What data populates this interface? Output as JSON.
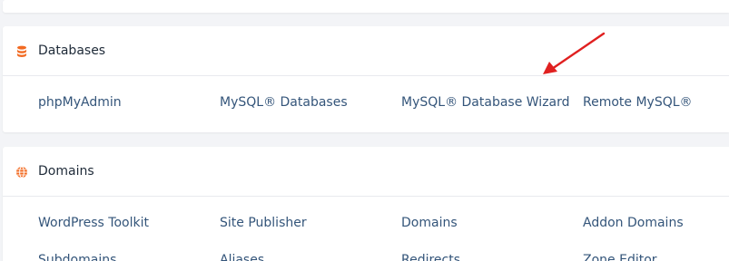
{
  "databases": {
    "title": "Databases",
    "icon": "database-icon",
    "accent": "#f26a21",
    "links": [
      "phpMyAdmin",
      "MySQL® Databases",
      "MySQL® Database Wizard",
      "Remote MySQL®"
    ]
  },
  "domains": {
    "title": "Domains",
    "icon": "globe-icon",
    "accent": "#f26a21",
    "links_row1": [
      "WordPress Toolkit",
      "Site Publisher",
      "Domains",
      "Addon Domains"
    ],
    "links_row2": [
      "Subdomains",
      "Aliases",
      "Redirects",
      "Zone Editor"
    ]
  },
  "annotation": {
    "type": "red-arrow",
    "color": "#e02020",
    "points_to": "MySQL® Database Wizard"
  }
}
